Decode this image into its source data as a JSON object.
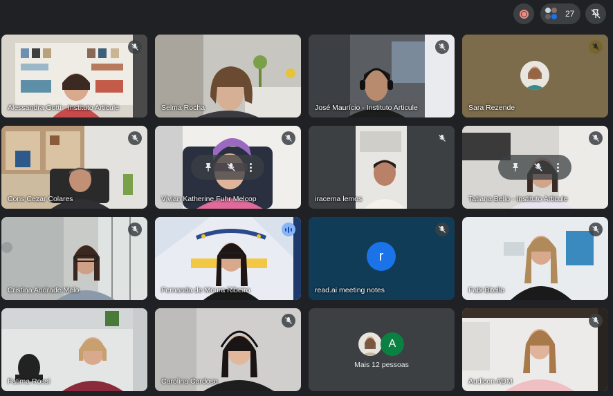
{
  "topbar": {
    "participant_count": "27"
  },
  "tiles": [
    {
      "name": "Alessandra Gotti - Instituto Articule",
      "muted": true
    },
    {
      "name": "Selma Rocha",
      "muted": false
    },
    {
      "name": "José Maurício - Instituto Articule",
      "muted": true
    },
    {
      "name": "Sara Rezende",
      "muted": true
    },
    {
      "name": "Cons Cezar Colares",
      "muted": true
    },
    {
      "name": "Vivian Katherine Fuhr Melcop",
      "muted": true
    },
    {
      "name": "iracema lemos",
      "muted": true
    },
    {
      "name": "Tatiana Bello - Instituto Articule",
      "muted": true
    },
    {
      "name": "Cristina Andrade Melo",
      "muted": true
    },
    {
      "name": "Fernanda de Moura Ribeiro",
      "speaking": true
    },
    {
      "name": "read.ai meeting notes",
      "muted": true,
      "avatar_letter": "r"
    },
    {
      "name": "Fabi Bitello",
      "muted": true
    },
    {
      "name": "Fatima Rossi",
      "muted": false
    },
    {
      "name": "Carolina Cardoso",
      "muted": true
    },
    {
      "overflow_label": "Mais 12 pessoas",
      "avatar_letter": "A"
    },
    {
      "name": "Audicon ADM",
      "muted": true
    }
  ],
  "colors": {
    "background": "#202124",
    "tile": "#3c4043",
    "accent": "#8ab4f8",
    "record": "#f28b82",
    "readai_avatar": "#1a73e8",
    "overflow_avatar": "#0b8043"
  },
  "icons": [
    "record-icon",
    "people-icon",
    "unpin-icon",
    "mic-off-icon",
    "speaking-icon",
    "pin-icon",
    "more-options-icon"
  ]
}
